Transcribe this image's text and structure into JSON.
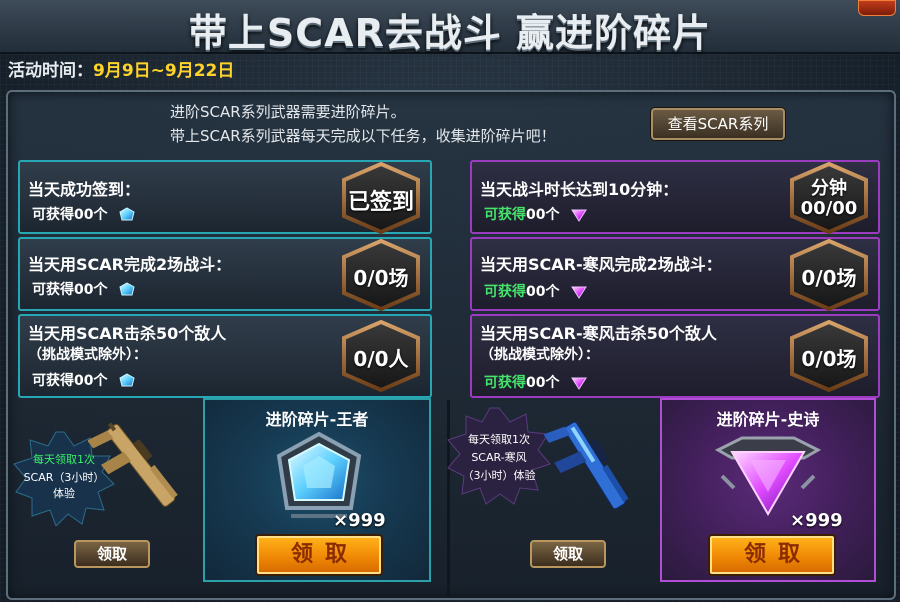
{
  "header": {
    "title": "带上SCAR去战斗  赢进阶碎片",
    "date_label": "活动时间：",
    "date_value": "9月9日~9月22日"
  },
  "intro": {
    "line1": "进阶SCAR系列武器需要进阶碎片。",
    "line2": "带上SCAR系列武器每天完成以下任务，收集进阶碎片吧！",
    "view_button": "查看SCAR系列"
  },
  "left_tasks": [
    {
      "title": "当天成功签到：",
      "reward_label": "可获得",
      "reward_value": "00个",
      "status": "已签到"
    },
    {
      "title": "当天用SCAR完成2场战斗：",
      "reward_label": "可获得",
      "reward_value": "00个",
      "status": "0/0场"
    },
    {
      "title": "当天用SCAR击杀50个敌人",
      "subtitle": "（挑战模式除外）：",
      "reward_label": "可获得",
      "reward_value": "00个",
      "status": "0/0人"
    }
  ],
  "right_tasks": [
    {
      "title": "当天战斗时长达到10分钟：",
      "reward_label": "可获得",
      "reward_value": "00个",
      "status_line1": "分钟",
      "status_line2": "00/00"
    },
    {
      "title": "当天用SCAR-寒风完成2场战斗：",
      "reward_label": "可获得",
      "reward_value": "00个",
      "status": "0/0场"
    },
    {
      "title": "当天用SCAR-寒风击杀50个敌人",
      "subtitle": "（挑战模式除外）：",
      "reward_label": "可获得",
      "reward_value": "00个",
      "status": "0/0场"
    }
  ],
  "left_reward": {
    "promo_line1": "每天领取1次",
    "promo_line2": "SCAR（3小时）",
    "promo_line3": "体验",
    "claim_small": "领取",
    "panel_title": "进阶碎片-王者",
    "quantity": "×999",
    "claim_big": "领取"
  },
  "right_reward": {
    "promo_line1": "每天领取1次",
    "promo_line2": "SCAR-寒风",
    "promo_line3": "（3小时）体验",
    "claim_small": "领取",
    "panel_title": "进阶碎片-史诗",
    "quantity": "×999",
    "claim_big": "领取"
  },
  "colors": {
    "accent_blue": "#27a7b3",
    "accent_purple": "#9a3bc0",
    "date_yellow": "#ffd42a",
    "reward_green": "#46e36c",
    "button_orange": "#f08a06"
  },
  "icons": {
    "blue_gem": "blue-crystal-fragment-icon",
    "purple_gem": "purple-crystal-fragment-icon"
  }
}
